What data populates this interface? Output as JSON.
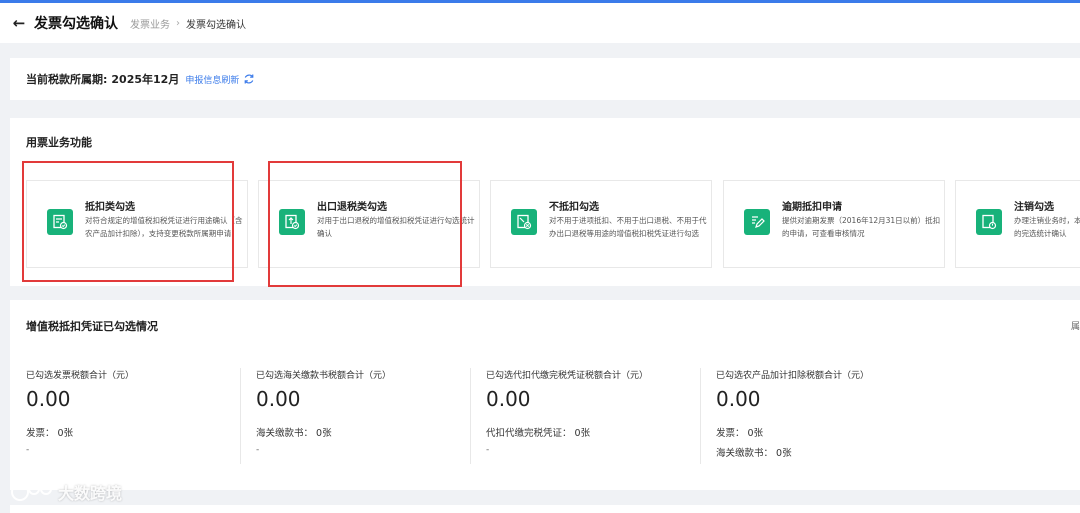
{
  "header": {
    "title": "发票勾选确认",
    "breadcrumb": [
      "发票业务",
      "发票勾选确认"
    ]
  },
  "period": {
    "label": "当前税款所属期:",
    "value": "2025年12月",
    "refresh_link": "申报信息刷新"
  },
  "functions": {
    "section_title": "用票业务功能",
    "tiles": [
      {
        "name": "抵扣类勾选",
        "desc": "对符合规定的增值税扣税凭证进行用途确认（含农产品加计扣除），支持变更税款所属期申请"
      },
      {
        "name": "出口退税类勾选",
        "desc": "对用于出口退税的增值税扣税凭证进行勾选统计确认"
      },
      {
        "name": "不抵扣勾选",
        "desc": "对不用于进项抵扣、不用于出口退税、不用于代办出口退税等用途的增值税扣税凭证进行勾选"
      },
      {
        "name": "逾期抵扣申请",
        "desc": "提供对逾期发票（2016年12月31日以前）抵扣的申请，可查看审核情况"
      },
      {
        "name": "注销勾选",
        "desc": "办理注销业务时，本期的税款所属期的完选统计确认"
      }
    ]
  },
  "stats": {
    "section_title": "增值税抵扣凭证已勾选情况",
    "more": "属",
    "columns": [
      {
        "label": "已勾选发票税额合计（元）",
        "amount": "0.00",
        "lines": [
          "发票：  0张",
          "-"
        ]
      },
      {
        "label": "已勾选海关缴款书税额合计（元）",
        "amount": "0.00",
        "lines": [
          "海关缴款书：  0张",
          "-"
        ]
      },
      {
        "label": "已勾选代扣代缴完税凭证税额合计（元）",
        "amount": "0.00",
        "lines": [
          "代扣代缴完税凭证：  0张",
          "-"
        ]
      },
      {
        "label": "已勾选农产品加计扣除税额合计（元）",
        "amount": "0.00",
        "lines": [
          "发票：  0张",
          "海关缴款书：  0张"
        ]
      }
    ]
  },
  "watermark": "大数跨境",
  "colors": {
    "accent": "#3b7bea",
    "icon_green": "#18b27a",
    "highlight_red": "#e23a3a"
  }
}
